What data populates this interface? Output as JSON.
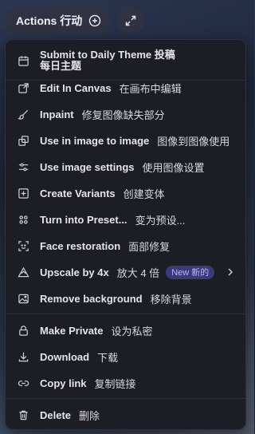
{
  "topbar": {
    "actions_label": "Actions 行动",
    "plus_icon": "plus-circle-icon",
    "expand_icon": "expand-arrows-icon"
  },
  "menu": {
    "items": [
      {
        "label": "Submit to Daily Theme 投稿",
        "label2": "每日主题",
        "zh": "",
        "icon": "calendar-icon"
      },
      {
        "label": "Edit In Canvas",
        "zh": "在画布中编辑",
        "icon": "external-edit-icon"
      },
      {
        "label": "Inpaint",
        "zh": "修复图像缺失部分",
        "icon": "brush-icon"
      },
      {
        "label": "Use in image to image",
        "zh": "图像到图像使用",
        "icon": "copy-layers-icon"
      },
      {
        "label": "Use image settings",
        "zh": "使用图像设置",
        "icon": "sliders-icon"
      },
      {
        "label": "Create Variants",
        "zh": "创建变体",
        "icon": "plus-square-icon"
      },
      {
        "label": "Turn into Preset...",
        "zh": "变为预设...",
        "icon": "grid-dots-icon"
      },
      {
        "label": "Face restoration",
        "zh": "面部修复",
        "icon": "face-icon"
      },
      {
        "label": "Upscale by 4x",
        "zh": "放大 4 倍",
        "badge": "New 新的",
        "icon": "upscale-triangle-icon"
      },
      {
        "label": "Remove background",
        "zh": "移除背景",
        "icon": "image-icon"
      },
      {
        "label": "Make Private",
        "zh": "设为私密",
        "icon": "lock-icon"
      },
      {
        "label": "Download",
        "zh": "下载",
        "icon": "download-icon"
      },
      {
        "label": "Copy link",
        "zh": "复制链接",
        "icon": "link-icon"
      },
      {
        "label": "Delete",
        "zh": "删除",
        "icon": "trash-icon"
      }
    ]
  },
  "colors": {
    "menu_bg": "#1c1d25",
    "pill_bg": "#2f3242",
    "badge_bg": "#3d3a7a",
    "badge_text": "#b9b4ff"
  }
}
